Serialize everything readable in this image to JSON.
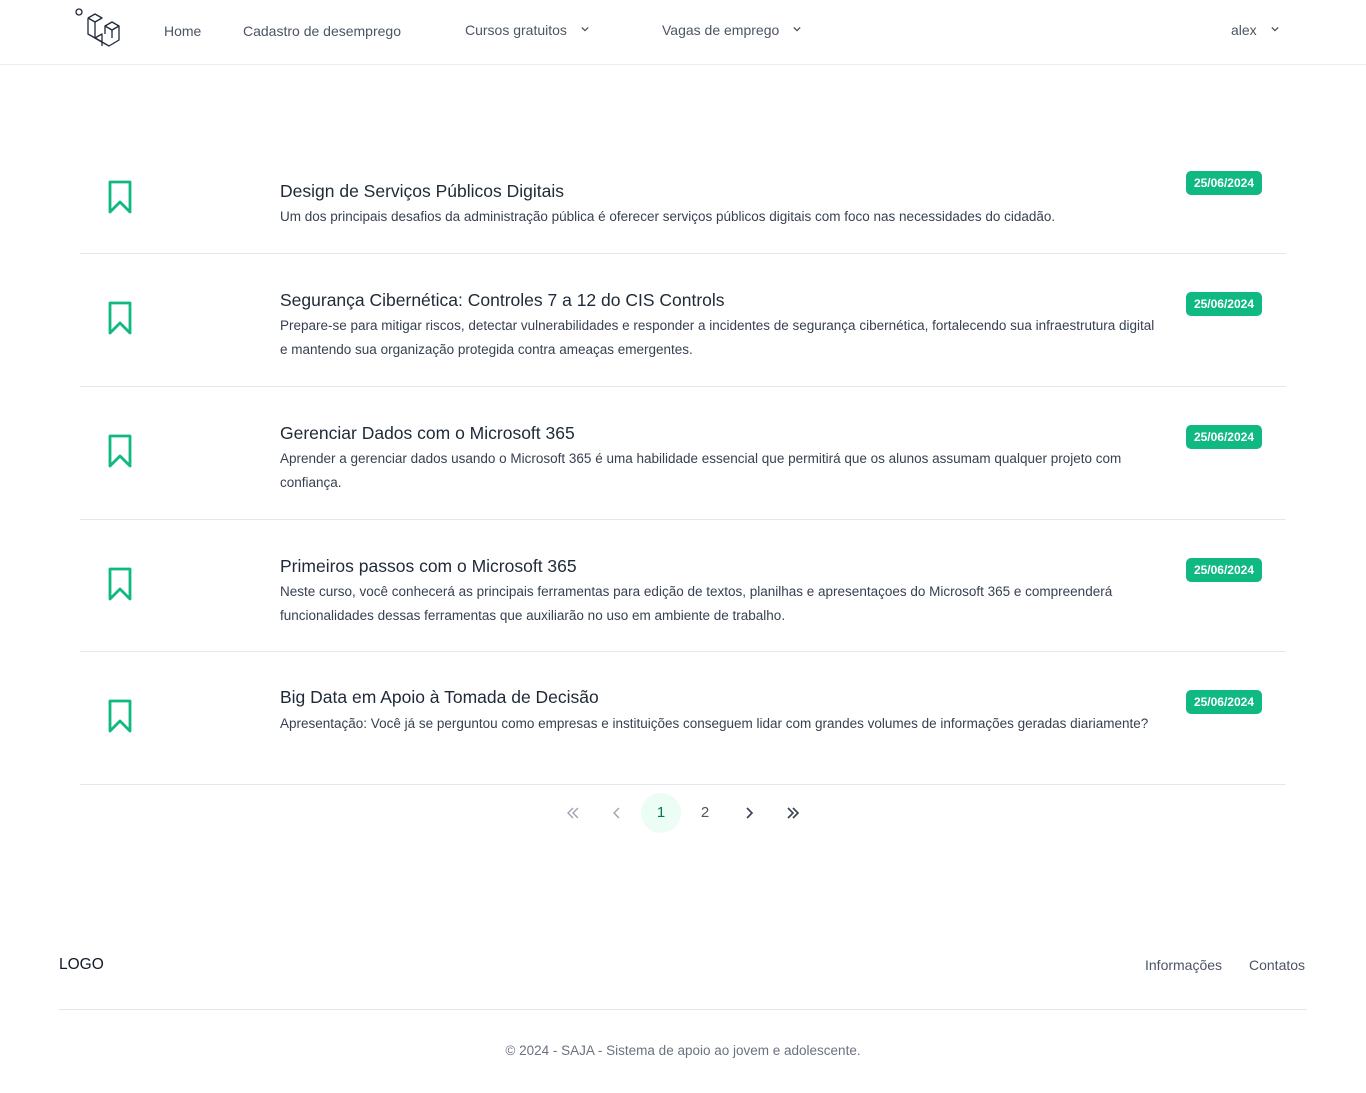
{
  "nav": {
    "home": "Home",
    "cadastro": "Cadastro de desemprego",
    "cursos": "Cursos gratuitos",
    "vagas": "Vagas de emprego",
    "user": "alex"
  },
  "courses": [
    {
      "title": "Design de Serviços Públicos Digitais",
      "description": "Um dos principais desafios da administração pública é oferecer serviços públicos digitais com foco nas necessidades do cidadão.",
      "date": "25/06/2024"
    },
    {
      "title": "Segurança Cibernética: Controles 7 a 12 do CIS Controls",
      "description": "Prepare-se para mitigar riscos, detectar vulnerabilidades e responder a incidentes de segurança cibernética, fortalecendo sua infraestrutura digital e mantendo sua organização protegida contra ameaças emergentes.",
      "date": "25/06/2024"
    },
    {
      "title": "Gerenciar Dados com o Microsoft 365",
      "description": "Aprender a gerenciar dados usando o Microsoft 365 é uma habilidade essencial que permitirá que os alunos assumam qualquer projeto com confiança.",
      "date": "25/06/2024"
    },
    {
      "title": "Primeiros passos com o Microsoft 365",
      "description": "Neste curso, você conhecerá as principais ferramentas para edição de textos, planilhas e apresentaçoes do Microsoft 365 e compreenderá funcionalidades dessas ferramentas que auxiliarão no uso em ambiente de trabalho.",
      "date": "25/06/2024"
    },
    {
      "title": "Big Data em Apoio à Tomada de Decisão",
      "description": "Apresentação: Você já se perguntou como empresas e instituições conseguem lidar com grandes volumes de informações geradas diariamente?",
      "date": "25/06/2024"
    }
  ],
  "pagination": {
    "pages": [
      "1",
      "2"
    ],
    "current": "1"
  },
  "footer": {
    "logo": "LOGO",
    "info": "Informações",
    "contact": "Contatos",
    "copyright": "© 2024 - SAJA - Sistema de apoio ao jovem e adolescente."
  },
  "colors": {
    "accent": "#10b981",
    "active_page_bg": "#ecfdf5"
  }
}
